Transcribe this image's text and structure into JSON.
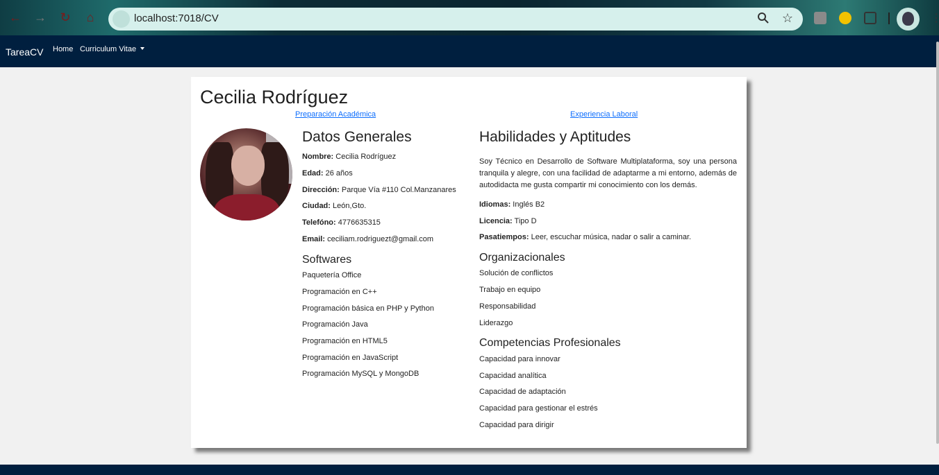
{
  "browser": {
    "url": "localhost:7018/CV"
  },
  "navbar": {
    "brand": "TareaCV",
    "home": "Home",
    "cv_menu": "Curriculum Vitae"
  },
  "cv": {
    "name": "Cecilia Rodríguez",
    "tabs": {
      "academic": "Preparación Académica",
      "work": "Experiencia Laboral"
    },
    "general": {
      "title": "Datos Generales",
      "items": [
        {
          "label": "Nombre:",
          "value": "Cecilia Rodríguez"
        },
        {
          "label": "Edad:",
          "value": "26 años"
        },
        {
          "label": "Dirección:",
          "value": "Parque Vía #110 Col.Manzanares"
        },
        {
          "label": "Ciudad:",
          "value": "León,Gto."
        },
        {
          "label": "Telefóno:",
          "value": "4776635315"
        },
        {
          "label": "Email:",
          "value": "ceciliam.rodriguezt@gmail.com"
        }
      ]
    },
    "softwares": {
      "title": "Softwares",
      "items": [
        "Paquetería Office",
        "Programación en C++",
        "Programación básica en PHP y Python",
        "Programación Java",
        "Programación en HTML5",
        "Programación en JavaScript",
        "Programación MySQL y MongoDB"
      ]
    },
    "skills": {
      "title": "Habilidades y Aptitudes",
      "summary": "Soy Técnico en Desarrollo de Software Multiplataforma, soy una persona tranquila y alegre, con una facilidad de adaptarme a mi entorno, además de autodidacta me gusta compartir mi conocimiento con los demás.",
      "items": [
        {
          "label": "Idiomas:",
          "value": "Inglés B2"
        },
        {
          "label": "Licencia:",
          "value": "Tipo D"
        },
        {
          "label": "Pasatiempos:",
          "value": "Leer, escuchar música, nadar o salir a caminar."
        }
      ]
    },
    "organizational": {
      "title": "Organizacionales",
      "items": [
        "Solución de conflictos",
        "Trabajo en equipo",
        "Responsabilidad",
        "Liderazgo"
      ]
    },
    "competencies": {
      "title": "Competencias Profesionales",
      "items": [
        "Capacidad para innovar",
        "Capacidad analítica",
        "Capacidad de adaptación",
        "Capacidad para gestionar el estrés",
        "Capacidad para dirigir"
      ]
    }
  }
}
